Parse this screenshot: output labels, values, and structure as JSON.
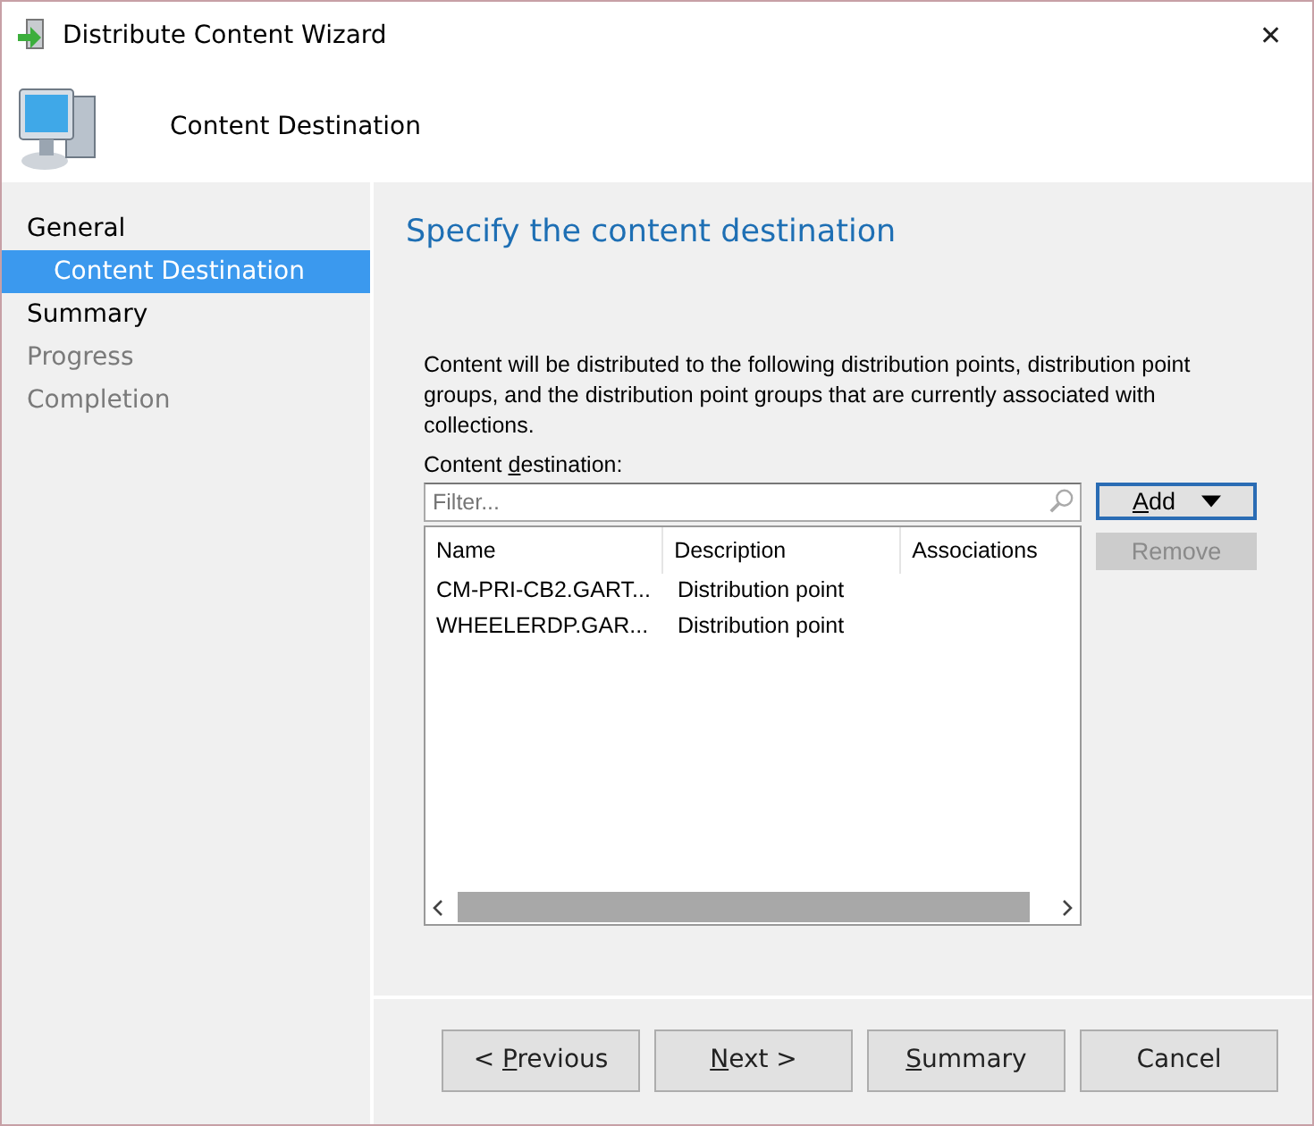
{
  "window": {
    "title": "Distribute Content Wizard",
    "close": "✕"
  },
  "header": {
    "title": "Content Destination"
  },
  "steps": [
    {
      "label": "General",
      "selected": false,
      "disabled": false,
      "children": [
        {
          "label": "Content Destination",
          "selected": true,
          "disabled": false
        }
      ]
    },
    {
      "label": "Summary",
      "selected": false,
      "disabled": false
    },
    {
      "label": "Progress",
      "selected": false,
      "disabled": true
    },
    {
      "label": "Completion",
      "selected": false,
      "disabled": true
    }
  ],
  "page": {
    "heading": "Specify the content destination",
    "description": "Content will be distributed to the following distribution points, distribution point groups, and the distribution point groups that are currently associated with collections.",
    "list_label": {
      "before": "Content ",
      "key": "d",
      "after": "estination:"
    },
    "filter": {
      "placeholder": "Filter..."
    },
    "columns": [
      "Name",
      "Description",
      "Associations"
    ],
    "rows": [
      {
        "cells": [
          "CM-PRI-CB2.GART...",
          "Distribution point"
        ]
      },
      {
        "cells": [
          "WHEELERDP.GAR...",
          "Distribution point"
        ]
      }
    ],
    "side_buttons": [
      {
        "label": {
          "key": "A",
          "after": "dd"
        },
        "dropdown": true,
        "disabled": false,
        "focused": true
      },
      {
        "label": {
          "after": "Remove"
        },
        "dropdown": false,
        "disabled": true,
        "focused": false
      }
    ]
  },
  "buttons": [
    {
      "label": {
        "before": "< ",
        "key": "P",
        "after": "revious"
      }
    },
    {
      "label": {
        "key": "N",
        "after": "ext >"
      }
    },
    {
      "label": {
        "key": "S",
        "after": "ummary"
      }
    },
    {
      "label": {
        "after": "Cancel"
      }
    }
  ]
}
